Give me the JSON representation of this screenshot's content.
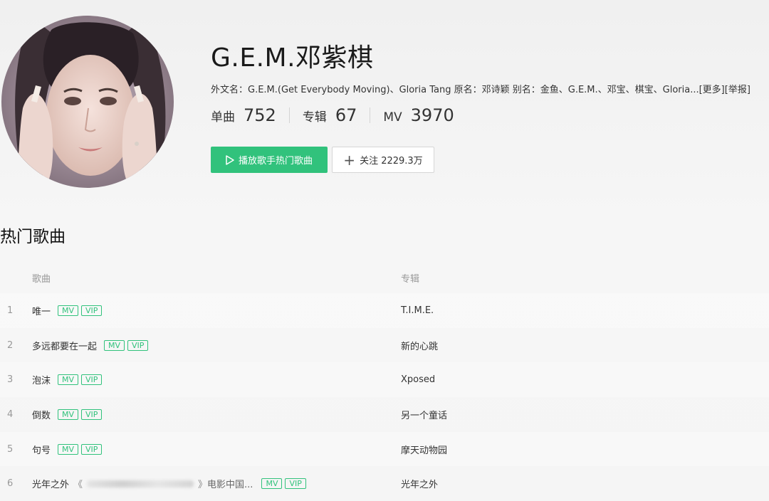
{
  "artist": {
    "name": "G.E.M.邓紫棋",
    "alias_line": "外文名：G.E.M.(Get Everybody Moving)、Gloria Tang 原名：邓诗颖 别名：金鱼、G.E.M.、邓宝、棋宝、Gloria...",
    "more_link": "[更多]",
    "report_link": "[举报]"
  },
  "stats": {
    "singles_label": "单曲",
    "singles_value": "752",
    "albums_label": "专辑",
    "albums_value": "67",
    "mv_label": "MV",
    "mv_value": "3970"
  },
  "actions": {
    "play_label": "播放歌手热门歌曲",
    "follow_label": "关注 2229.3万"
  },
  "section": {
    "title": "热门歌曲"
  },
  "table": {
    "headers": {
      "song": "歌曲",
      "album": "专辑"
    },
    "rows": [
      {
        "num": "1",
        "title": "唯一",
        "mv": "MV",
        "vip": "VIP",
        "album": "T.I.M.E."
      },
      {
        "num": "2",
        "title": "多远都要在一起",
        "mv": "MV",
        "vip": "VIP",
        "album": "新的心跳"
      },
      {
        "num": "3",
        "title": "泡沫",
        "mv": "MV",
        "vip": "VIP",
        "album": "Xposed"
      },
      {
        "num": "4",
        "title": "倒数",
        "mv": "MV",
        "vip": "VIP",
        "album": "另一个童话"
      },
      {
        "num": "5",
        "title": "句号",
        "mv": "MV",
        "vip": "VIP",
        "album": "摩天动物园"
      },
      {
        "num": "6",
        "title": "光年之外",
        "open_quote": "《",
        "close_quote": "》",
        "subtitle": "电影中国...",
        "mv": "MV",
        "vip": "VIP",
        "album": "光年之外"
      }
    ]
  },
  "colors": {
    "accent": "#31c27c",
    "background": "#f4f4f4"
  },
  "icons": {
    "play": "play-triangle-icon",
    "follow": "plus-icon"
  }
}
